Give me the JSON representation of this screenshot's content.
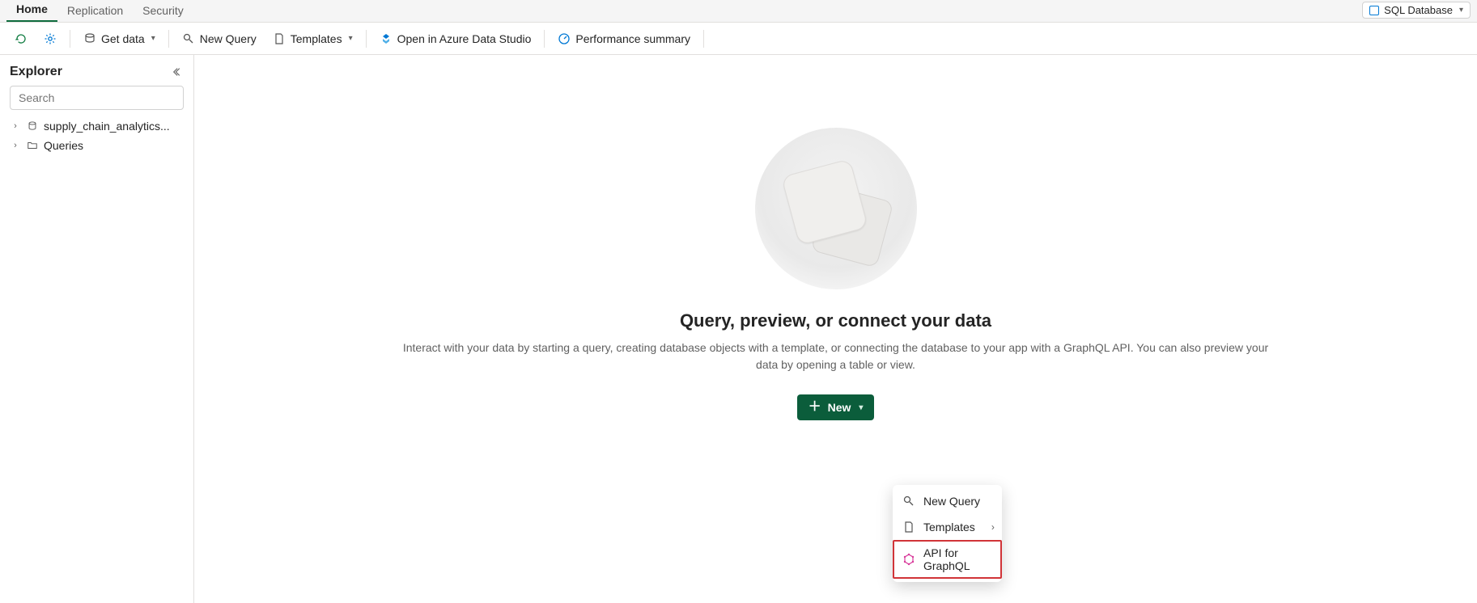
{
  "tabs": {
    "home": "Home",
    "replication": "Replication",
    "security": "Security"
  },
  "db_badge": {
    "label": "SQL Database"
  },
  "toolbar": {
    "get_data": "Get data",
    "new_query": "New Query",
    "templates": "Templates",
    "open_ads": "Open in Azure Data Studio",
    "perf_summary": "Performance summary"
  },
  "sidebar": {
    "title": "Explorer",
    "search_placeholder": "Search",
    "items": [
      {
        "label": "supply_chain_analytics..."
      },
      {
        "label": "Queries"
      }
    ]
  },
  "hero": {
    "title": "Query, preview, or connect your data",
    "subtitle": "Interact with your data by starting a query, creating database objects with a template, or connecting the database to your app with a GraphQL API. You can also preview your data by opening a table or view.",
    "new_label": "New"
  },
  "dropdown": {
    "new_query": "New Query",
    "templates": "Templates",
    "api_graphql": "API for GraphQL"
  }
}
